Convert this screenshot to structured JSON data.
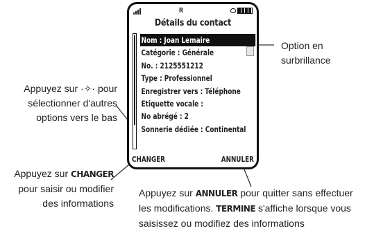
{
  "phone": {
    "status": {
      "signal_icon": "signal-bars-icon",
      "indicator": "R",
      "battery_icon": "battery-full-icon"
    },
    "title": "Détails du contact",
    "rows": [
      "Nom : Joan Lemaire",
      "Catégorie : Générale",
      "No. : 2125551212",
      "Type : Professionnel",
      "Enregistrer vers : Téléphone",
      "Etiquette vocale :",
      "No abrégé : 2",
      "Sonnerie dédiée : Continental"
    ],
    "softkeys": {
      "left": "CHANGER",
      "right": "ANNULER"
    }
  },
  "callouts": {
    "highlight": {
      "line1": "Option en",
      "line2": "surbrillance"
    },
    "nav": {
      "pre": "Appuyez sur ",
      "post": " pour",
      "line2": "sélectionner d'autres",
      "line3": "options vers le bas"
    },
    "changer": {
      "pre": "Appuyez sur ",
      "key": "CHANGER",
      "line2": "pour saisir ou modifier",
      "line3": "des informations"
    },
    "annuler": {
      "pre": "Appuyez sur ",
      "key": "ANNULER",
      "mid": " pour quitter sans effectuer",
      "line2a": "les modifications. ",
      "key2": "TERMINE",
      "line2b": " s'affiche lorsque vous",
      "line3": "saisissez ou modifiez des informations"
    }
  }
}
